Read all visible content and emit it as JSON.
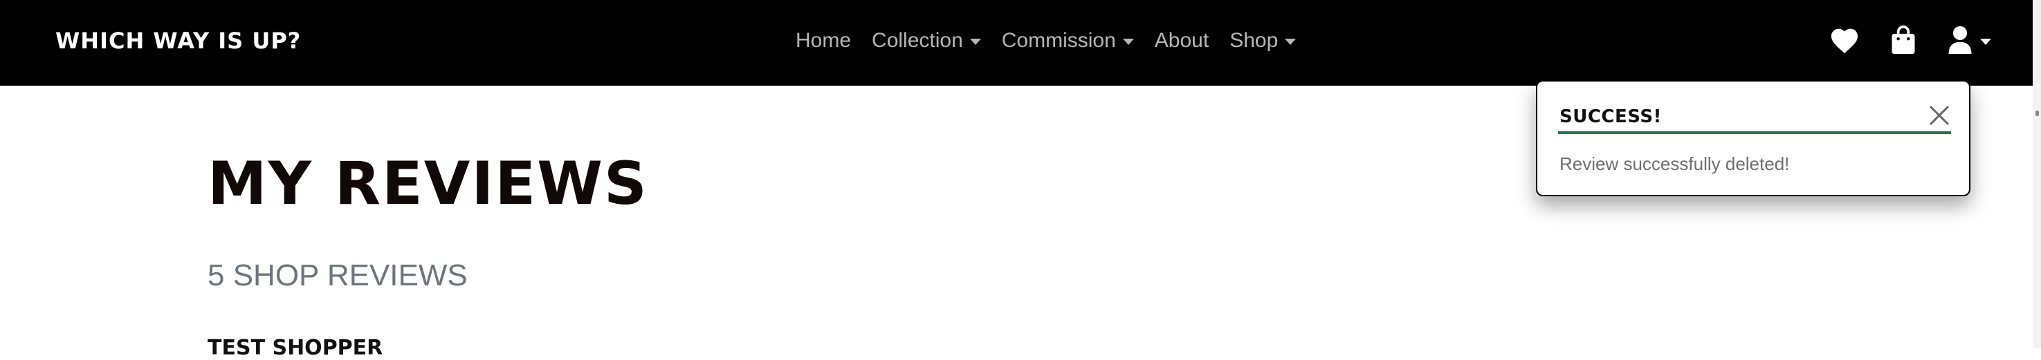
{
  "navbar": {
    "brand": "Which Way Is Up?",
    "links": [
      {
        "label": "Home",
        "dropdown": false
      },
      {
        "label": "Collection",
        "dropdown": true
      },
      {
        "label": "Commission",
        "dropdown": true
      },
      {
        "label": "About",
        "dropdown": false
      },
      {
        "label": "Shop",
        "dropdown": true
      }
    ],
    "icons": [
      "heart-icon",
      "shopping-bag-icon",
      "user-icon"
    ]
  },
  "toast": {
    "title": "Success!",
    "message": "Review successfully deleted!",
    "accent_color": "#28744a"
  },
  "main": {
    "title": "My Reviews",
    "subtitle": "5 Shop Reviews",
    "first_reviewer": "Test Shopper"
  },
  "colors": {
    "navbar_bg": "#000000",
    "nav_link": "#b7b7b7",
    "title": "#110808",
    "subtitle": "#6c757d"
  }
}
